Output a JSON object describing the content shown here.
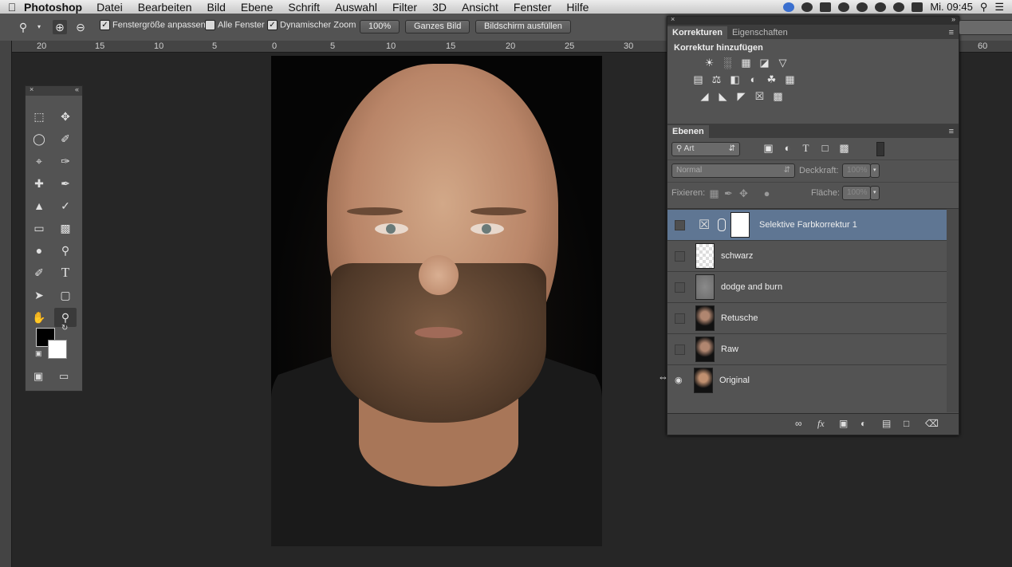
{
  "menubar": {
    "apple_icon": "apple-icon",
    "app_name": "Photoshop",
    "items": [
      "Datei",
      "Bearbeiten",
      "Bild",
      "Ebene",
      "Schrift",
      "Auswahl",
      "Filter",
      "3D",
      "Ansicht",
      "Fenster",
      "Hilfe"
    ],
    "clock": "Mi. 09:45"
  },
  "options": {
    "fit_window": "Fenstergröße anpassen",
    "all_windows": "Alle Fenster",
    "dynamic_zoom": "Dynamischer Zoom",
    "zoom_percent": "100%",
    "whole_image": "Ganzes Bild",
    "fill_screen": "Bildschirm ausfüllen"
  },
  "ruler": {
    "top_labels": [
      "20",
      "15",
      "10",
      "5",
      "0",
      "5",
      "10",
      "15",
      "20",
      "25",
      "30",
      "60"
    ]
  },
  "adjustments": {
    "tabs": [
      "Korrekturen",
      "Eigenschaften"
    ],
    "title": "Korrektur hinzufügen"
  },
  "layers": {
    "tab": "Ebenen",
    "filter_kind": "Art",
    "blend_mode": "Normal",
    "opacity_label": "Deckkraft:",
    "opacity_value": "100%",
    "lock_label": "Fixieren:",
    "fill_label": "Fläche:",
    "fill_value": "100%",
    "items": [
      {
        "name": "Selektive Farbkorrektur 1",
        "selected": true
      },
      {
        "name": "schwarz",
        "selected": false
      },
      {
        "name": "dodge and burn",
        "selected": false
      },
      {
        "name": "Retusche",
        "selected": false
      },
      {
        "name": "Raw",
        "selected": false
      },
      {
        "name": "Original",
        "selected": false
      }
    ]
  },
  "colors": {
    "foreground": "#000000",
    "background": "#ffffff",
    "selection": "#5f7693"
  }
}
